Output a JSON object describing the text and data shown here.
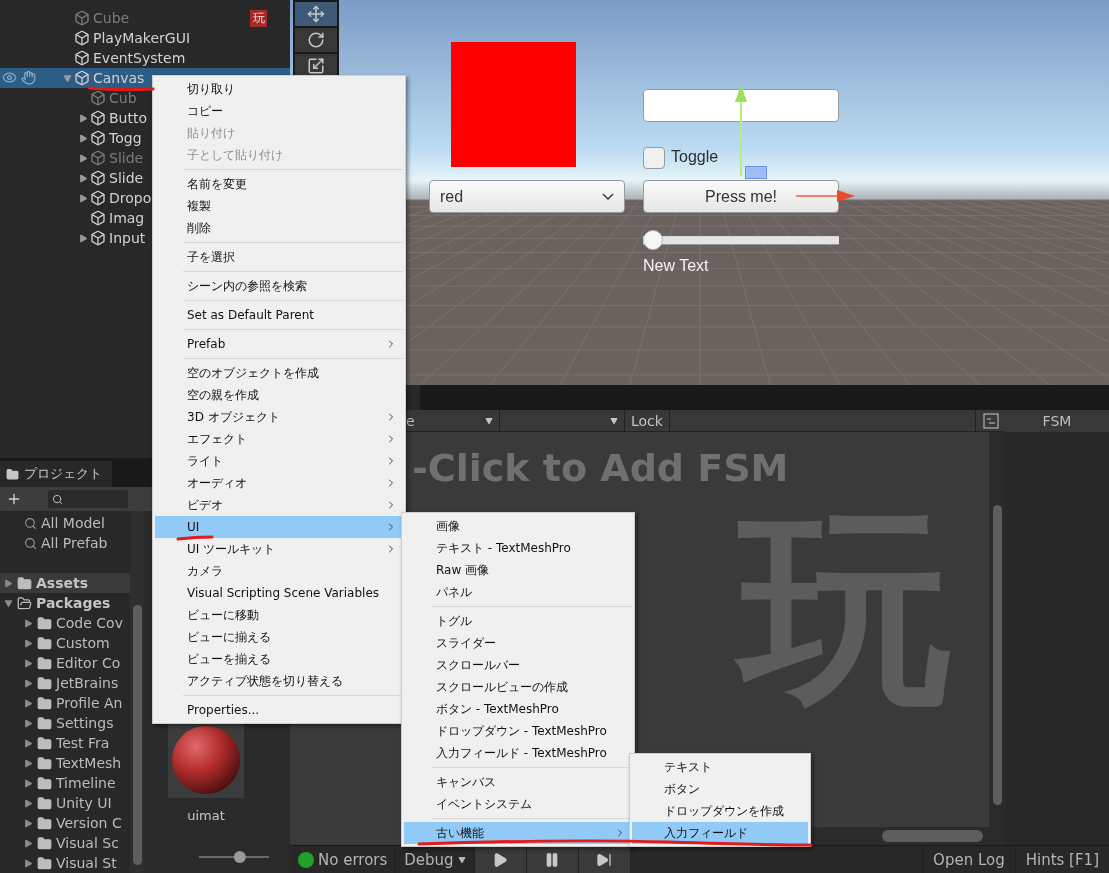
{
  "hierarchy": {
    "items": [
      {
        "label": "Cube",
        "disabled": true,
        "selected": false,
        "badge": "玩"
      },
      {
        "label": "PlayMakerGUI",
        "disabled": false,
        "selected": false
      },
      {
        "label": "EventSystem",
        "disabled": false,
        "selected": false
      },
      {
        "label": "Canvas",
        "disabled": false,
        "selected": true,
        "expanded": true,
        "children": [
          {
            "label": "Cub",
            "disabled": true,
            "selected": false
          },
          {
            "label": "Butto",
            "disabled": false,
            "selected": false,
            "expanded": false
          },
          {
            "label": "Togg",
            "disabled": false,
            "selected": false,
            "expanded": false
          },
          {
            "label": "Slide",
            "disabled": true,
            "selected": false,
            "expanded": false
          },
          {
            "label": "Slide",
            "disabled": false,
            "selected": false,
            "expanded": false
          },
          {
            "label": "Dropo",
            "disabled": false,
            "selected": false,
            "expanded": false
          },
          {
            "label": "Imag",
            "disabled": false,
            "selected": false
          },
          {
            "label": "Input",
            "disabled": false,
            "selected": false,
            "expanded": false
          }
        ]
      }
    ]
  },
  "scene": {
    "dropdown": "red",
    "button": "Press me!",
    "toggle": {
      "label": "Toggle",
      "checked": false
    },
    "slider": {
      "level": 0
    },
    "text": "New Text"
  },
  "project": {
    "tab": "プロジェクト",
    "favorites": [
      "All Model",
      "All Prefab"
    ],
    "tree": [
      {
        "label": "Assets",
        "selected": true,
        "expanded": false
      },
      {
        "label": "Packages",
        "selected": false,
        "expanded": true,
        "children": [
          {
            "label": "Code Cov",
            "selected": false,
            "expanded": false
          },
          {
            "label": "Custom",
            "selected": false,
            "expanded": false
          },
          {
            "label": "Editor Co",
            "selected": false,
            "expanded": false
          },
          {
            "label": "JetBrains",
            "selected": false,
            "expanded": false
          },
          {
            "label": "Profile An",
            "selected": false,
            "expanded": false
          },
          {
            "label": "Settings",
            "selected": false,
            "expanded": false
          },
          {
            "label": "Test Fra",
            "selected": false,
            "expanded": false
          },
          {
            "label": "TextMesh",
            "selected": false,
            "expanded": false
          },
          {
            "label": "Timeline",
            "selected": false,
            "expanded": false
          },
          {
            "label": "Unity UI",
            "selected": false,
            "expanded": false
          },
          {
            "label": "Version C",
            "selected": false,
            "expanded": false
          },
          {
            "label": "Visual Sc",
            "selected": false,
            "expanded": false
          },
          {
            "label": "Visual St",
            "selected": false,
            "expanded": false
          }
        ]
      }
    ],
    "assets": [
      {
        "label": "uimat"
      }
    ],
    "zoom": {
      "level": 0.6
    }
  },
  "fsm": {
    "dropdown": "e",
    "lock": "Lock",
    "tab": "FSM",
    "hint": "-Click to Add FSM",
    "logo": "玩"
  },
  "status_bar": {
    "errors": "No errors",
    "mode": "Debug",
    "log": "Open Log",
    "hints": "Hints [F1]"
  },
  "context_menu": {
    "groups": [
      [
        {
          "label": "切り取り",
          "disabled": false,
          "submenu": false,
          "selected": false
        },
        {
          "label": "コピー",
          "disabled": false,
          "submenu": false,
          "selected": false
        },
        {
          "label": "貼り付け",
          "disabled": true,
          "submenu": false,
          "selected": false
        },
        {
          "label": "子として貼り付け",
          "disabled": true,
          "submenu": false,
          "selected": false
        }
      ],
      [
        {
          "label": "名前を変更",
          "disabled": false,
          "submenu": false,
          "selected": false
        },
        {
          "label": "複製",
          "disabled": false,
          "submenu": false,
          "selected": false
        },
        {
          "label": "削除",
          "disabled": false,
          "submenu": false,
          "selected": false
        }
      ],
      [
        {
          "label": "子を選択",
          "disabled": false,
          "submenu": false,
          "selected": false
        }
      ],
      [
        {
          "label": "シーン内の参照を検索",
          "disabled": false,
          "submenu": false,
          "selected": false
        }
      ],
      [
        {
          "label": "Set as Default Parent",
          "disabled": false,
          "submenu": false,
          "selected": false
        }
      ],
      [
        {
          "label": "Prefab",
          "disabled": false,
          "submenu": true,
          "selected": false
        }
      ],
      [
        {
          "label": "空のオブジェクトを作成",
          "disabled": false,
          "submenu": false,
          "selected": false
        },
        {
          "label": "空の親を作成",
          "disabled": false,
          "submenu": false,
          "selected": false
        },
        {
          "label": "3D オブジェクト",
          "disabled": false,
          "submenu": true,
          "selected": false
        },
        {
          "label": "エフェクト",
          "disabled": false,
          "submenu": true,
          "selected": false
        },
        {
          "label": "ライト",
          "disabled": false,
          "submenu": true,
          "selected": false
        },
        {
          "label": "オーディオ",
          "disabled": false,
          "submenu": true,
          "selected": false
        },
        {
          "label": "ビデオ",
          "disabled": false,
          "submenu": true,
          "selected": false
        },
        {
          "label": "UI",
          "disabled": false,
          "submenu": true,
          "selected": true
        },
        {
          "label": "UI ツールキット",
          "disabled": false,
          "submenu": true,
          "selected": false
        },
        {
          "label": "カメラ",
          "disabled": false,
          "submenu": false,
          "selected": false
        },
        {
          "label": "Visual Scripting Scene Variables",
          "disabled": false,
          "submenu": false,
          "selected": false
        },
        {
          "label": "ビューに移動",
          "disabled": false,
          "submenu": false,
          "selected": false
        },
        {
          "label": "ビューに揃える",
          "disabled": false,
          "submenu": false,
          "selected": false
        },
        {
          "label": "ビューを揃える",
          "disabled": false,
          "submenu": false,
          "selected": false
        },
        {
          "label": "アクティブ状態を切り替える",
          "disabled": false,
          "submenu": false,
          "selected": false
        }
      ],
      [
        {
          "label": "Properties...",
          "disabled": false,
          "submenu": false,
          "selected": false
        }
      ]
    ]
  },
  "ui_submenu": {
    "groups": [
      [
        {
          "label": "画像",
          "disabled": false,
          "submenu": false,
          "selected": false
        },
        {
          "label": "テキスト - TextMeshPro",
          "disabled": false,
          "submenu": false,
          "selected": false
        },
        {
          "label": "Raw 画像",
          "disabled": false,
          "submenu": false,
          "selected": false
        },
        {
          "label": "パネル",
          "disabled": false,
          "submenu": false,
          "selected": false
        }
      ],
      [
        {
          "label": "トグル",
          "disabled": false,
          "submenu": false,
          "selected": false
        },
        {
          "label": "スライダー",
          "disabled": false,
          "submenu": false,
          "selected": false
        },
        {
          "label": "スクロールバー",
          "disabled": false,
          "submenu": false,
          "selected": false
        },
        {
          "label": "スクロールビューの作成",
          "disabled": false,
          "submenu": false,
          "selected": false
        },
        {
          "label": "ボタン - TextMeshPro",
          "disabled": false,
          "submenu": false,
          "selected": false
        },
        {
          "label": "ドロップダウン - TextMeshPro",
          "disabled": false,
          "submenu": false,
          "selected": false
        },
        {
          "label": "入力フィールド - TextMeshPro",
          "disabled": false,
          "submenu": false,
          "selected": false
        }
      ],
      [
        {
          "label": "キャンバス",
          "disabled": false,
          "submenu": false,
          "selected": false
        },
        {
          "label": "イベントシステム",
          "disabled": false,
          "submenu": false,
          "selected": false
        }
      ],
      [
        {
          "label": "古い機能",
          "disabled": false,
          "submenu": true,
          "selected": true
        }
      ]
    ]
  },
  "legacy_submenu": {
    "groups": [
      [
        {
          "label": "テキスト",
          "disabled": false,
          "submenu": false,
          "selected": false
        },
        {
          "label": "ボタン",
          "disabled": false,
          "submenu": false,
          "selected": false
        },
        {
          "label": "ドロップダウンを作成",
          "disabled": false,
          "submenu": false,
          "selected": false
        },
        {
          "label": "入力フィールド",
          "disabled": false,
          "submenu": false,
          "selected": true
        }
      ]
    ]
  }
}
